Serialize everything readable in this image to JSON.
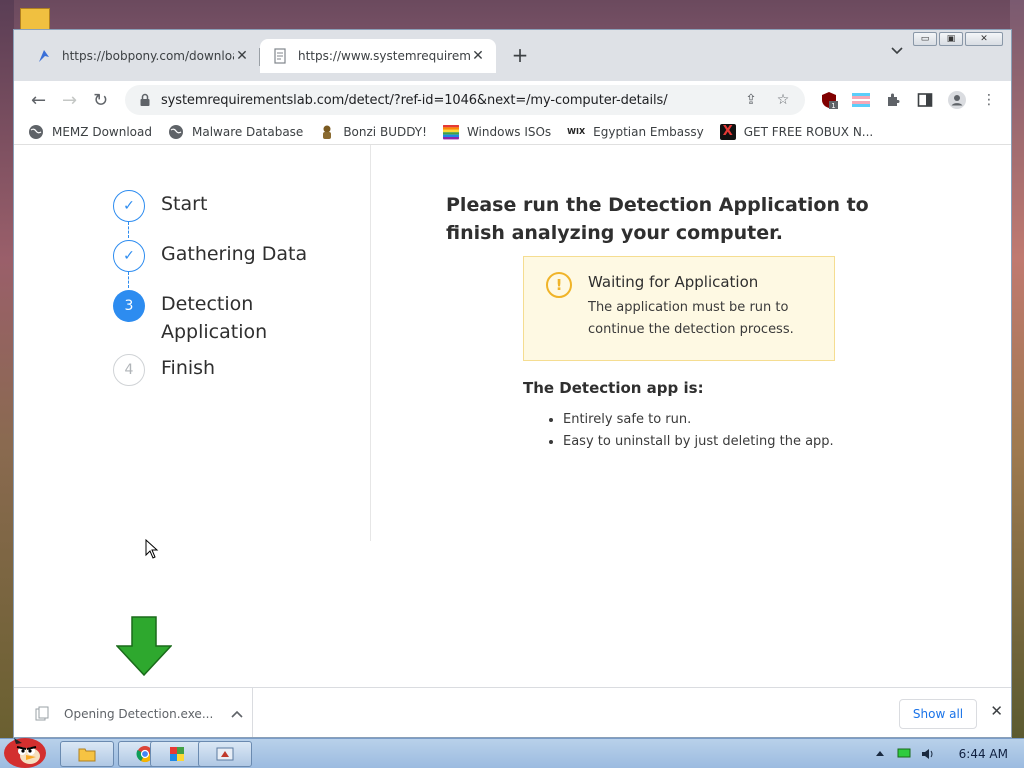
{
  "browser": {
    "tabs": [
      {
        "title": "https://bobpony.com/downloads",
        "close": "✕"
      },
      {
        "title": "https://www.systemrequirements",
        "close": "✕"
      }
    ],
    "new_tab": "+",
    "tab_dropdown": "⌄",
    "window_controls": {
      "minimize": "▭",
      "maximize": "▣",
      "close": "✕"
    },
    "nav": {
      "back": "←",
      "forward": "→",
      "reload": "↻"
    },
    "url": "systemrequirementslab.com/detect/?ref-id=1046&next=/my-computer-details/",
    "lock": "🔒",
    "omnibox_icons": {
      "share": "⇪",
      "star": "☆"
    },
    "extensions": {
      "ublock_badge": "1",
      "menu": "⋮"
    },
    "bookmarks": [
      {
        "label": "MEMZ Download",
        "icon_color": "#555555"
      },
      {
        "label": "Malware Database",
        "icon_color": "#555555"
      },
      {
        "label": "Bonzi BUDDY!",
        "icon_color": "#7a5a20"
      },
      {
        "label": "Windows ISOs",
        "icon_color": "#e53935"
      },
      {
        "label": "Egyptian Embassy",
        "icon_color": "#222222",
        "icon_text": "WIX"
      },
      {
        "label": "GET FREE ROBUX N...",
        "icon_color": "#111111",
        "icon_text": "X"
      }
    ]
  },
  "wizard": {
    "steps": [
      {
        "label": "Start",
        "status": "done",
        "mark": "✓"
      },
      {
        "label": "Gathering Data",
        "status": "done",
        "mark": "✓"
      },
      {
        "label": "Detection Application",
        "status": "current",
        "mark": "3"
      },
      {
        "label": "Finish",
        "status": "todo",
        "mark": "4"
      }
    ]
  },
  "content": {
    "heading": "Please run the Detection Application to finish analyzing your computer.",
    "alert": {
      "icon": "!",
      "title": "Waiting for Application",
      "body": "The application must be run to continue the detection process."
    },
    "app_heading": "The Detection app is:",
    "app_points": [
      "Entirely safe to run.",
      "Easy to uninstall by just deleting the app."
    ]
  },
  "download_bar": {
    "item_label": "Opening Detection.exe...",
    "chevron": "⌃",
    "show_all": "Show all",
    "close": "✕"
  },
  "taskbar": {
    "time": "6:44 AM"
  },
  "colors": {
    "accent": "#2d8cf0",
    "alert_bg": "#fef9e3",
    "alert_border": "#f5dd91",
    "warning": "#f0b429",
    "arrow_green": "#2ea82e"
  }
}
